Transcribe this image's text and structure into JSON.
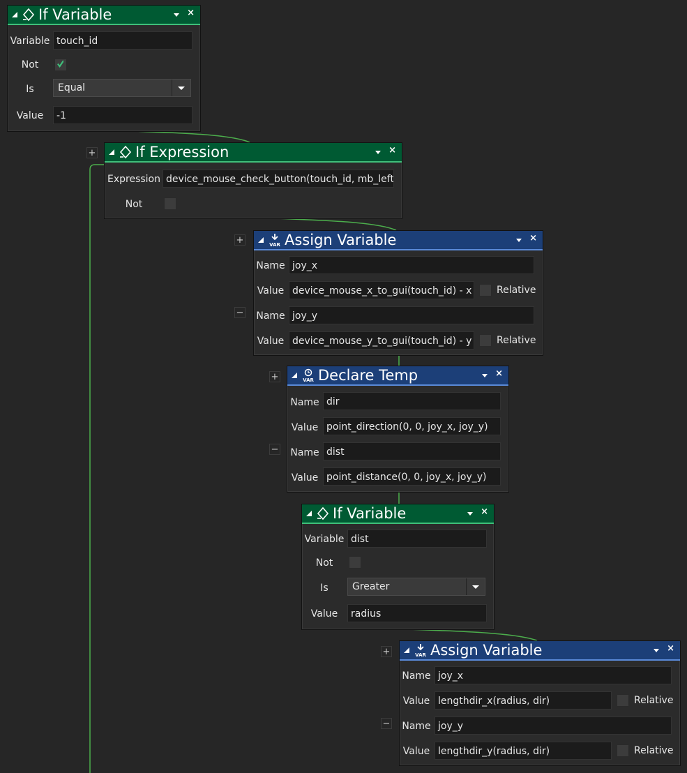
{
  "colors": {
    "if_header": "#005a33",
    "action_header": "#1c3f78",
    "wire": "#4cae4c",
    "background": "#262626"
  },
  "blocks": {
    "if_variable_1": {
      "title": "If Variable",
      "icon": "if-variable-icon",
      "variable_label": "Variable",
      "variable_value": "touch_id",
      "not_label": "Not",
      "not_checked": true,
      "is_label": "Is",
      "is_value": "Equal",
      "value_label": "Value",
      "value_value": "-1"
    },
    "if_expression": {
      "title": "If Expression",
      "icon": "if-expression-icon",
      "expression_label": "Expression",
      "expression_value": "device_mouse_check_button(touch_id, mb_left)",
      "not_label": "Not",
      "not_checked": false
    },
    "assign_variable_1": {
      "title": "Assign Variable",
      "icon": "assign-variable-icon",
      "rows": [
        {
          "name_label": "Name",
          "name_value": "joy_x",
          "value_label": "Value",
          "value_value": "device_mouse_x_to_gui(touch_id) - x",
          "relative_label": "Relative"
        },
        {
          "name_label": "Name",
          "name_value": "joy_y",
          "value_label": "Value",
          "value_value": "device_mouse_y_to_gui(touch_id) - y",
          "relative_label": "Relative"
        }
      ]
    },
    "declare_temp": {
      "title": "Declare Temp",
      "icon": "declare-temp-icon",
      "rows": [
        {
          "name_label": "Name",
          "name_value": "dir",
          "value_label": "Value",
          "value_value": "point_direction(0, 0, joy_x, joy_y)"
        },
        {
          "name_label": "Name",
          "name_value": "dist",
          "value_label": "Value",
          "value_value": "point_distance(0, 0, joy_x, joy_y)"
        }
      ]
    },
    "if_variable_2": {
      "title": "If Variable",
      "icon": "if-variable-icon",
      "variable_label": "Variable",
      "variable_value": "dist",
      "not_label": "Not",
      "not_checked": false,
      "is_label": "Is",
      "is_value": "Greater",
      "value_label": "Value",
      "value_value": "radius"
    },
    "assign_variable_2": {
      "title": "Assign Variable",
      "icon": "assign-variable-icon",
      "rows": [
        {
          "name_label": "Name",
          "name_value": "joy_x",
          "value_label": "Value",
          "value_value": "lengthdir_x(radius, dir)",
          "relative_label": "Relative"
        },
        {
          "name_label": "Name",
          "name_value": "joy_y",
          "value_label": "Value",
          "value_value": "lengthdir_y(radius, dir)",
          "relative_label": "Relative"
        }
      ]
    }
  },
  "controls": {
    "plus": "+",
    "minus": "−",
    "close": "×"
  }
}
